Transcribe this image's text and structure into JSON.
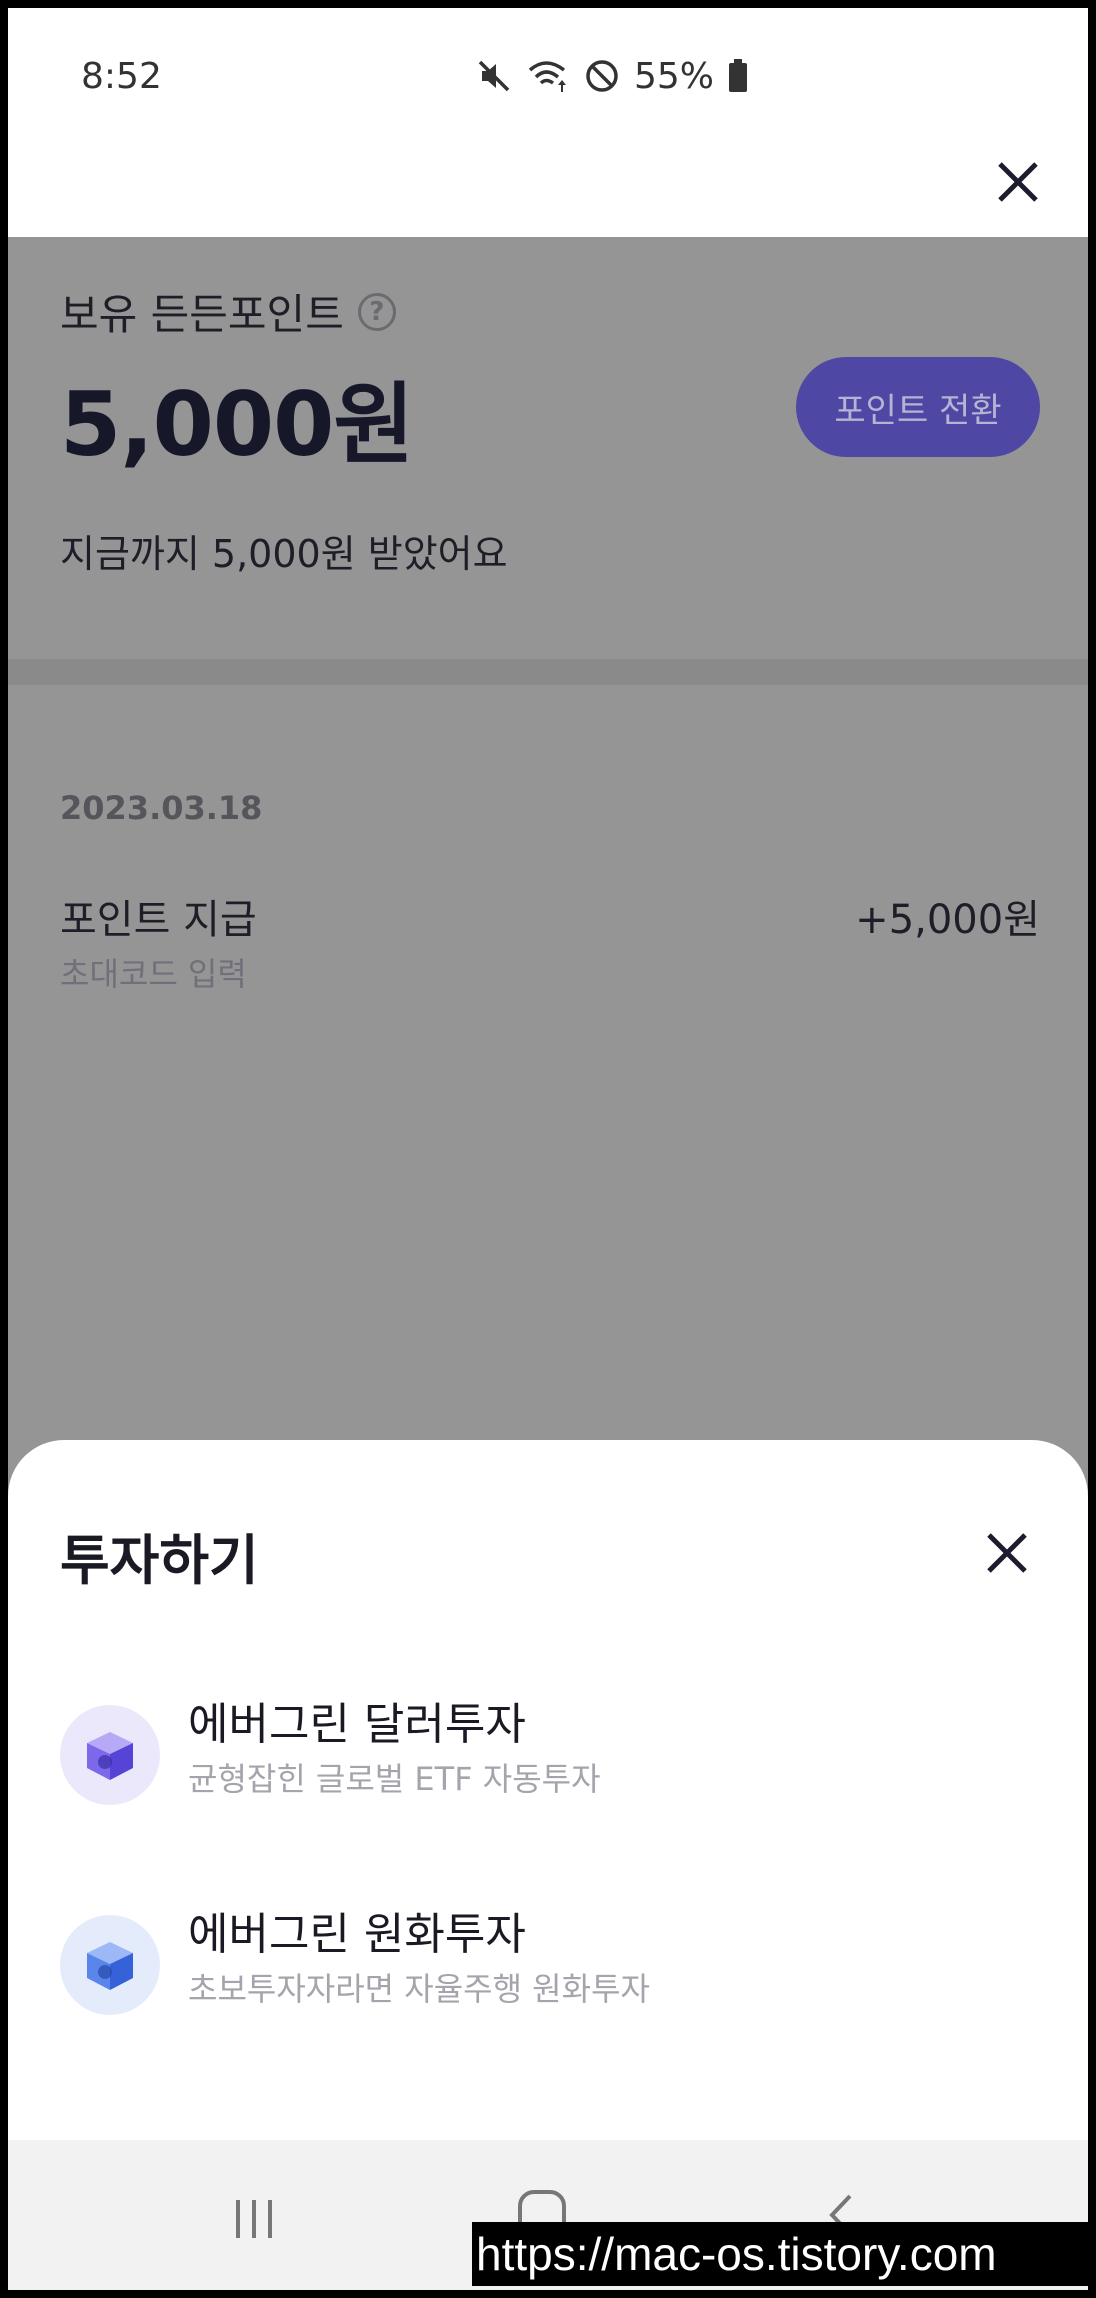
{
  "status_bar": {
    "time": "8:52",
    "battery": "55%"
  },
  "points": {
    "label": "보유 든든포인트",
    "help_glyph": "?",
    "amount": "5,000원",
    "convert_button": "포인트 전환",
    "received_summary": "지금까지 5,000원 받았어요"
  },
  "history": [
    {
      "date": "2023.03.18",
      "title": "포인트 지급",
      "subtitle": "초대코드 입력",
      "amount": "+5,000원"
    }
  ],
  "sheet": {
    "title": "투자하기",
    "options": [
      {
        "title": "에버그린 달러투자",
        "subtitle": "균형잡힌 글로벌 ETF 자동투자",
        "icon": "dollar-cube-icon",
        "color": "#6b5ce7"
      },
      {
        "title": "에버그린 원화투자",
        "subtitle": "초보투자자라면 자율주행 원화투자",
        "icon": "won-cube-icon",
        "color": "#3a6de0"
      }
    ]
  },
  "watermark": "https://mac-os.tistory.com"
}
